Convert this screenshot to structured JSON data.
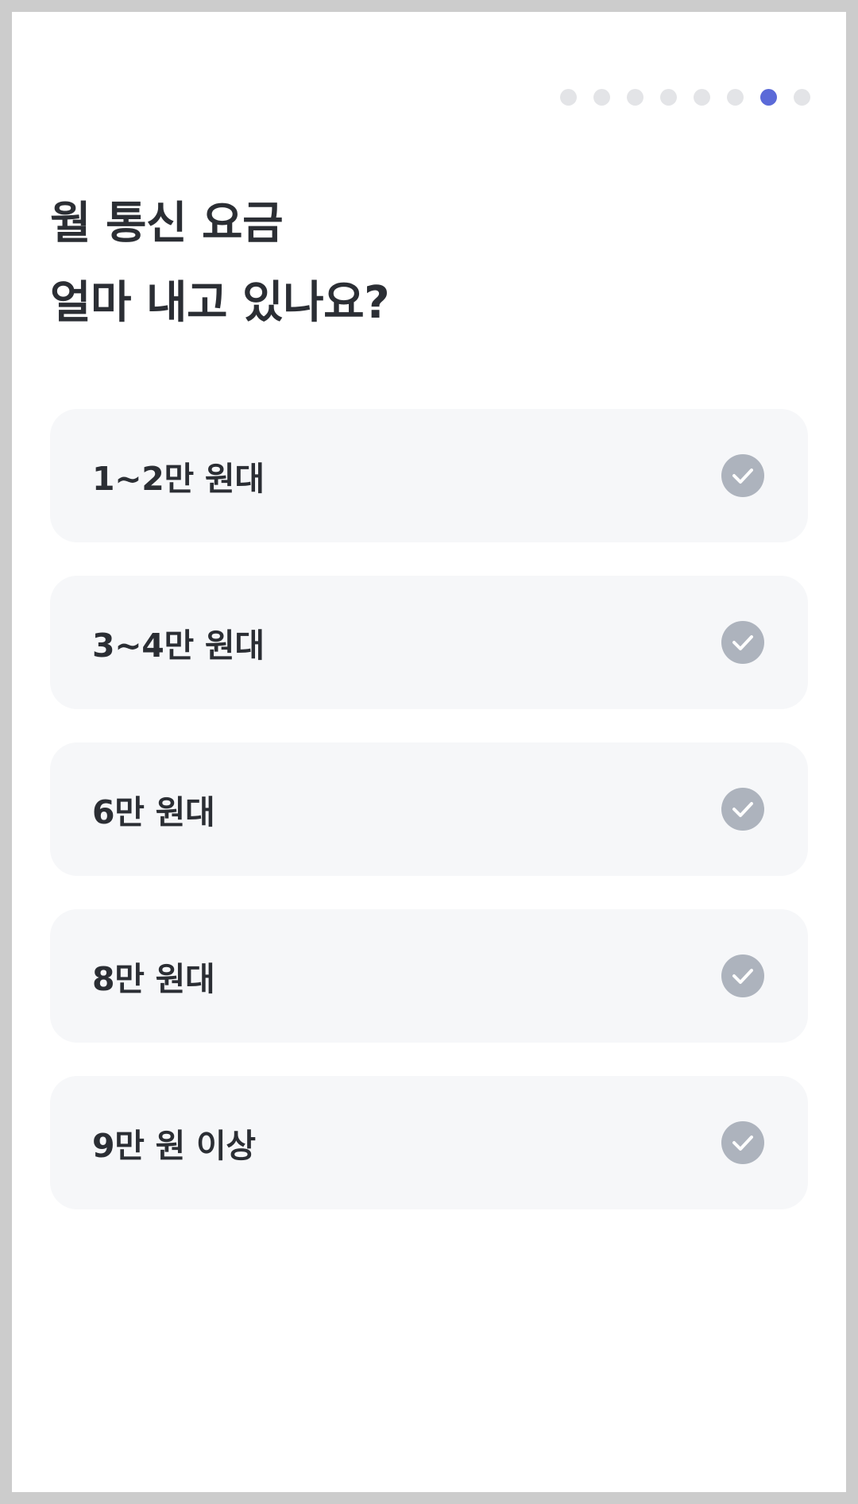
{
  "progress": {
    "total_steps": 8,
    "current_step": 7,
    "active_color": "#5b6ad8",
    "inactive_color": "#e3e4e7"
  },
  "question": {
    "line1": "월 통신 요금",
    "line2": "얼마 내고 있나요?"
  },
  "options": [
    {
      "label": "1~2만 원대",
      "icon": "check-circle-icon"
    },
    {
      "label": "3~4만 원대",
      "icon": "check-circle-icon"
    },
    {
      "label": "6만 원대",
      "icon": "check-circle-icon"
    },
    {
      "label": "8만 원대",
      "icon": "check-circle-icon"
    },
    {
      "label": "9만 원 이상",
      "icon": "check-circle-icon"
    }
  ]
}
